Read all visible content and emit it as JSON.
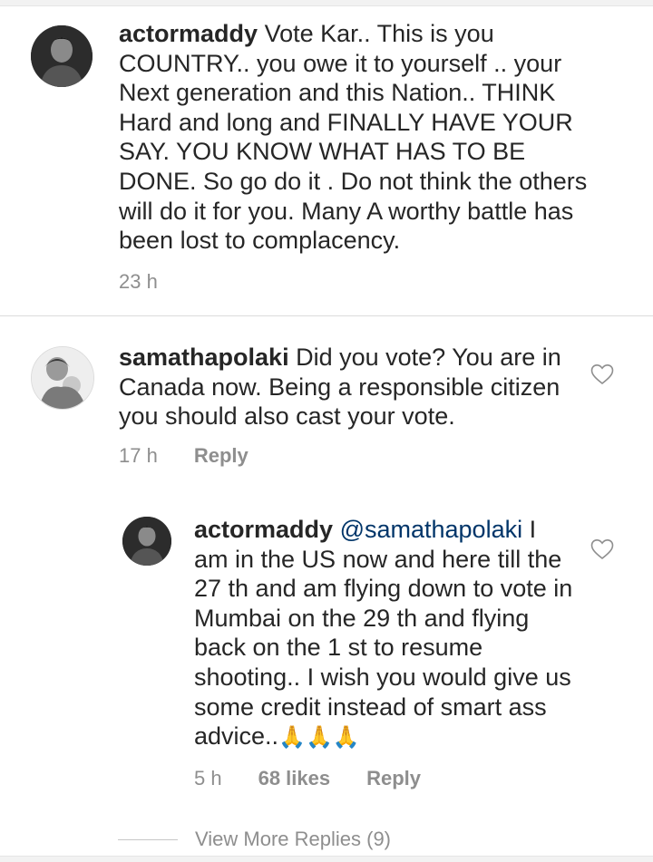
{
  "comments": [
    {
      "username": "actormaddy",
      "text": "Vote Kar.. This is you COUNTRY.. you owe it to yourself .. your Next generation and this Nation.. THINK Hard and long and FINALLY HAVE  YOUR SAY.  YOU KNOW WHAT HAS TO BE DONE. So go do it . Do not think the others will do it for you. Many A worthy battle has been lost to complacency.",
      "time": "23 h"
    },
    {
      "username": "samathapolaki",
      "text": "Did you vote? You are in Canada now. Being a responsible citizen you should also cast your vote.",
      "time": "17 h",
      "reply_label": "Reply"
    }
  ],
  "reply": {
    "username": "actormaddy",
    "mention": "@samathapolaki",
    "text": "I am in the US now and here till the 27 th and am flying down to vote in Mumbai on the 29 th and flying back on the 1 st to resume shooting.. I wish you would give us some credit instead of smart ass advice..",
    "emoji": "🙏🙏🙏",
    "time": "5 h",
    "likes": "68 likes",
    "reply_label": "Reply"
  },
  "view_more": "View More Replies (9)",
  "icons": {
    "heart": "heart-outline-icon",
    "avatar_style": "grayscale"
  }
}
